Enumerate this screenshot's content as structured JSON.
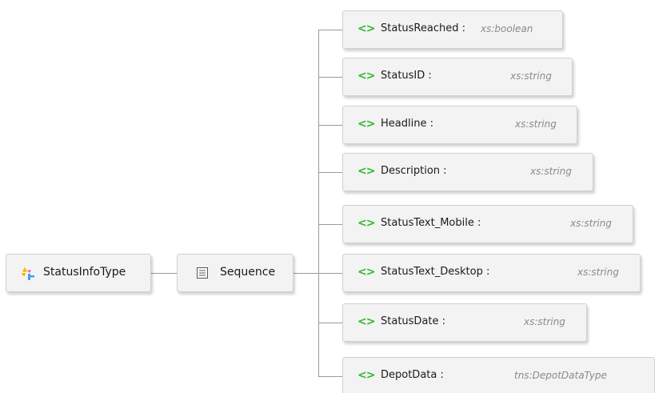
{
  "root": {
    "label": "StatusInfoType",
    "icon": "complex-type-icon"
  },
  "sequence": {
    "label": "Sequence",
    "icon": "sequence-icon"
  },
  "elements": [
    {
      "tag": "<>",
      "name": "StatusReached :",
      "type": "xs:boolean"
    },
    {
      "tag": "<>",
      "name": "StatusID :",
      "type": "xs:string"
    },
    {
      "tag": "<>",
      "name": "Headline :",
      "type": "xs:string"
    },
    {
      "tag": "<>",
      "name": "Description :",
      "type": "xs:string"
    },
    {
      "tag": "<>",
      "name": "StatusText_Mobile :",
      "type": "xs:string"
    },
    {
      "tag": "<>",
      "name": "StatusText_Desktop :",
      "type": "xs:string"
    },
    {
      "tag": "<>",
      "name": "StatusDate :",
      "type": "xs:string"
    },
    {
      "tag": "<>",
      "name": "DepotData :",
      "type": "tns:DepotDataType"
    }
  ],
  "colors": {
    "element_tag": "#2eb82e",
    "connector": "#9a9a9a",
    "node_bg": "#f3f3f3"
  }
}
